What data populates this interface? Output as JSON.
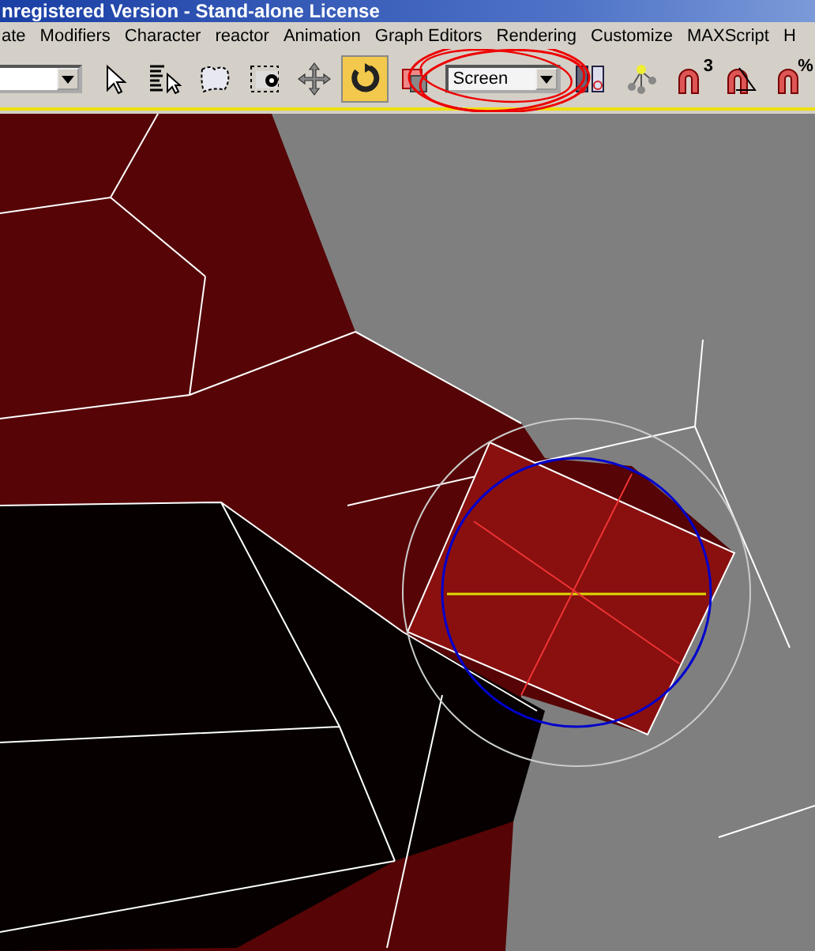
{
  "window": {
    "title": "nregistered Version - Stand-alone License"
  },
  "menu": [
    "ate",
    "Modifiers",
    "Character",
    "reactor",
    "Animation",
    "Graph Editors",
    "Rendering",
    "Customize",
    "MAXScript",
    "H"
  ],
  "toolbar": {
    "tools": [
      {
        "kind": "select",
        "selected": false
      },
      {
        "kind": "select-by-name",
        "selected": false
      },
      {
        "kind": "lasso",
        "selected": false
      },
      {
        "kind": "window-crossing",
        "selected": false
      },
      {
        "kind": "move",
        "selected": false
      },
      {
        "kind": "rotate",
        "selected": true
      },
      {
        "kind": "scale",
        "selected": false
      }
    ],
    "coordinate_system": {
      "value": "Screen"
    },
    "tools_right": [
      {
        "kind": "pivot"
      },
      {
        "kind": "link"
      },
      {
        "kind": "snap",
        "label": "3"
      },
      {
        "kind": "angle-snap"
      },
      {
        "kind": "percent-snap",
        "label": "%"
      }
    ]
  }
}
